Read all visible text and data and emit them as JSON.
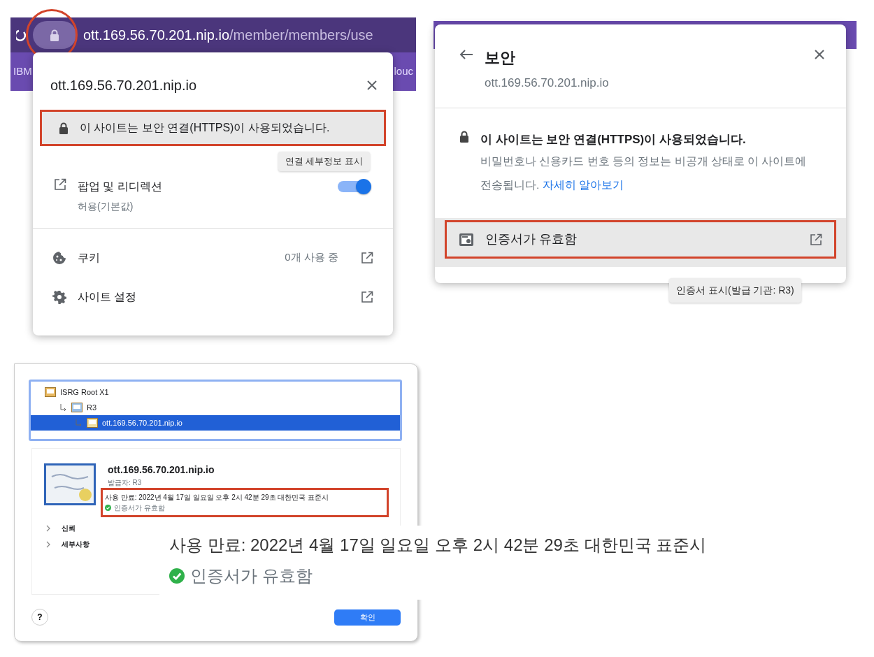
{
  "browser": {
    "address": {
      "host": "ott.169.56.70.201.nip.io",
      "path": "/member/members/use",
      "lock_circled": true
    },
    "bookmarks": [
      "IBM",
      "louc"
    ],
    "site_info": {
      "title": "ott.169.56.70.201.nip.io",
      "connection": {
        "text": "이 사이트는 보안 연결(HTTPS)이 사용되었습니다.",
        "highlighted": true
      },
      "tooltip": "연결 세부정보 표시",
      "permission": {
        "label": "팝업 및 리디렉션",
        "sub": "허용(기본값)",
        "on": true
      },
      "rows": [
        {
          "kind": "cookie",
          "label": "쿠키",
          "value": "0개 사용 중"
        },
        {
          "kind": "gear",
          "label": "사이트 설정"
        }
      ]
    }
  },
  "security": {
    "title": "보안",
    "host": "ott.169.56.70.201.nip.io",
    "heading": "이 사이트는 보안 연결(HTTPS)이 사용되었습니다.",
    "body": "비밀번호나 신용카드 번호 등의 정보는 비공개 상태로 이 사이트에 전송됩니다.",
    "link": "자세히 알아보기",
    "certificate_row": {
      "label": "인증서가 유효함",
      "highlighted": true
    },
    "tooltip": "인증서 표시(발급 기관: R3)"
  },
  "certificate_dialog": {
    "chain": [
      {
        "label": "ISRG Root X1",
        "selected": false,
        "children": [
          {
            "label": "R3",
            "selected": false,
            "children": [
              {
                "label": "ott.169.56.70.201.nip.io",
                "selected": true
              }
            ]
          }
        ]
      }
    ],
    "name": "ott.169.56.70.201.nip.io",
    "issuer": "발급자: R3",
    "expiry": "사용 만료: 2022년 4월 17일 일요일 오후 2시 42분 29초 대한민국 표준시",
    "status": "인증서가 유효함",
    "highlighted": true,
    "sections": [
      "신뢰",
      "세부사항"
    ],
    "help": "?",
    "ok": "확인"
  },
  "callout": {
    "expiry": "사용 만료: 2022년 4월 17일 일요일 오후 2시 42분 29초 대한민국 표준시",
    "status": "인증서가 유효함"
  }
}
